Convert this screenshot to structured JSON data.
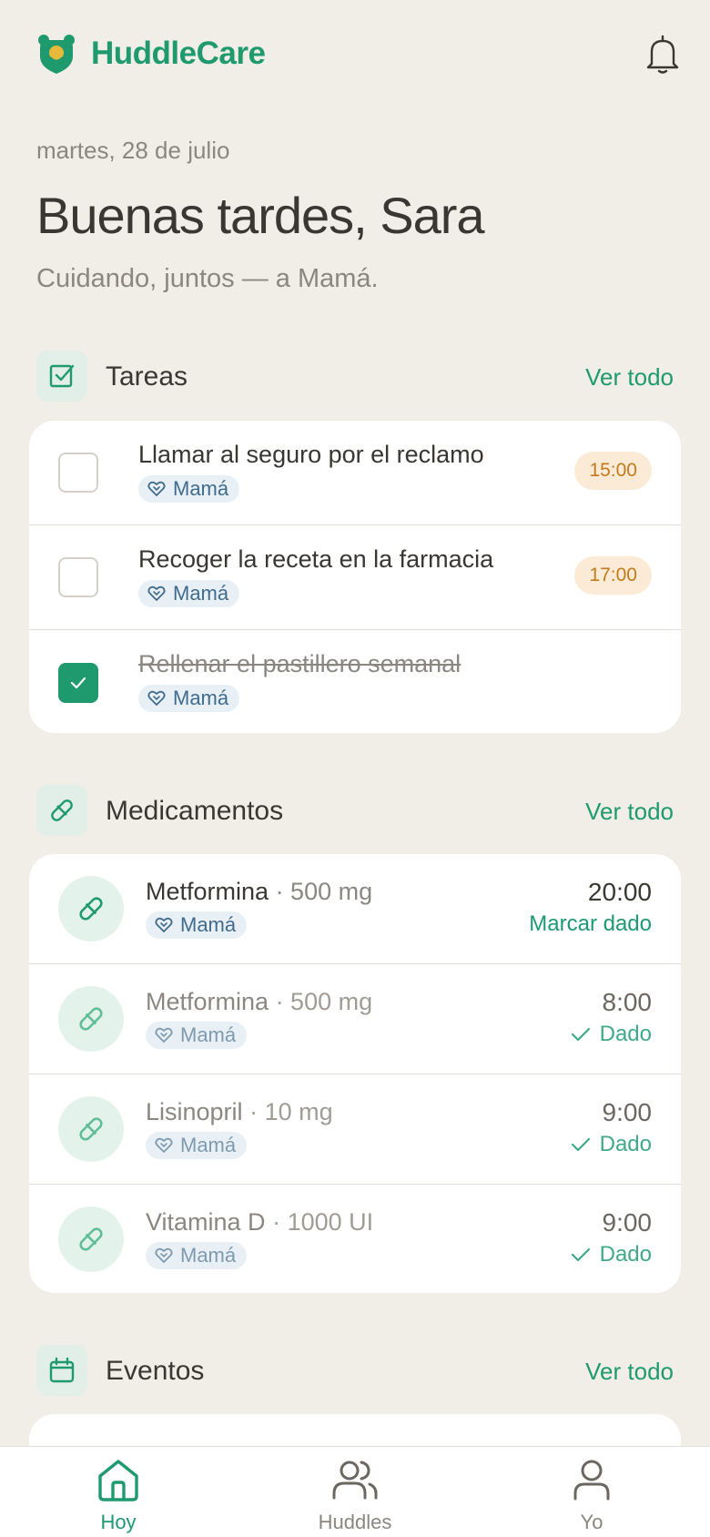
{
  "app": {
    "name": "HuddleCare"
  },
  "header": {
    "date": "martes, 28 de julio",
    "greeting": "Buenas tardes, Sara",
    "subtitle": "Cuidando, juntos — a Mamá."
  },
  "tasks": {
    "title": "Tareas",
    "see_all": "Ver todo",
    "items": [
      {
        "title": "Llamar al seguro por el reclamo",
        "person": "Mamá",
        "time": "15:00",
        "done": false
      },
      {
        "title": "Recoger la receta en la farmacia",
        "person": "Mamá",
        "time": "17:00",
        "done": false
      },
      {
        "title": "Rellenar el pastillero semanal",
        "person": "Mamá",
        "time": "",
        "done": true
      }
    ]
  },
  "medications": {
    "title": "Medicamentos",
    "see_all": "Ver todo",
    "items": [
      {
        "name": "Metformina",
        "dose": "· 500 mg",
        "person": "Mamá",
        "time": "20:00",
        "action": "Marcar dado",
        "given": false
      },
      {
        "name": "Metformina",
        "dose": "· 500 mg",
        "person": "Mamá",
        "time": "8:00",
        "action": "Dado",
        "given": true
      },
      {
        "name": "Lisinopril",
        "dose": "· 10 mg",
        "person": "Mamá",
        "time": "9:00",
        "action": "Dado",
        "given": true
      },
      {
        "name": "Vitamina D",
        "dose": "· 1000 UI",
        "person": "Mamá",
        "time": "9:00",
        "action": "Dado",
        "given": true
      }
    ]
  },
  "events": {
    "title": "Eventos",
    "see_all": "Ver todo"
  },
  "nav": {
    "items": [
      {
        "label": "Hoy",
        "icon": "home-icon",
        "active": true
      },
      {
        "label": "Huddles",
        "icon": "users-icon",
        "active": false
      },
      {
        "label": "Yo",
        "icon": "user-icon",
        "active": false
      }
    ]
  },
  "colors": {
    "accent": "#1E9A6E",
    "background": "#F1EEE8",
    "card": "#FFFFFF",
    "time_pill_bg": "#FBEBD6",
    "time_pill_text": "#C57A1B",
    "chip_bg": "#E9F0F5",
    "chip_text": "#3F6B8D"
  }
}
